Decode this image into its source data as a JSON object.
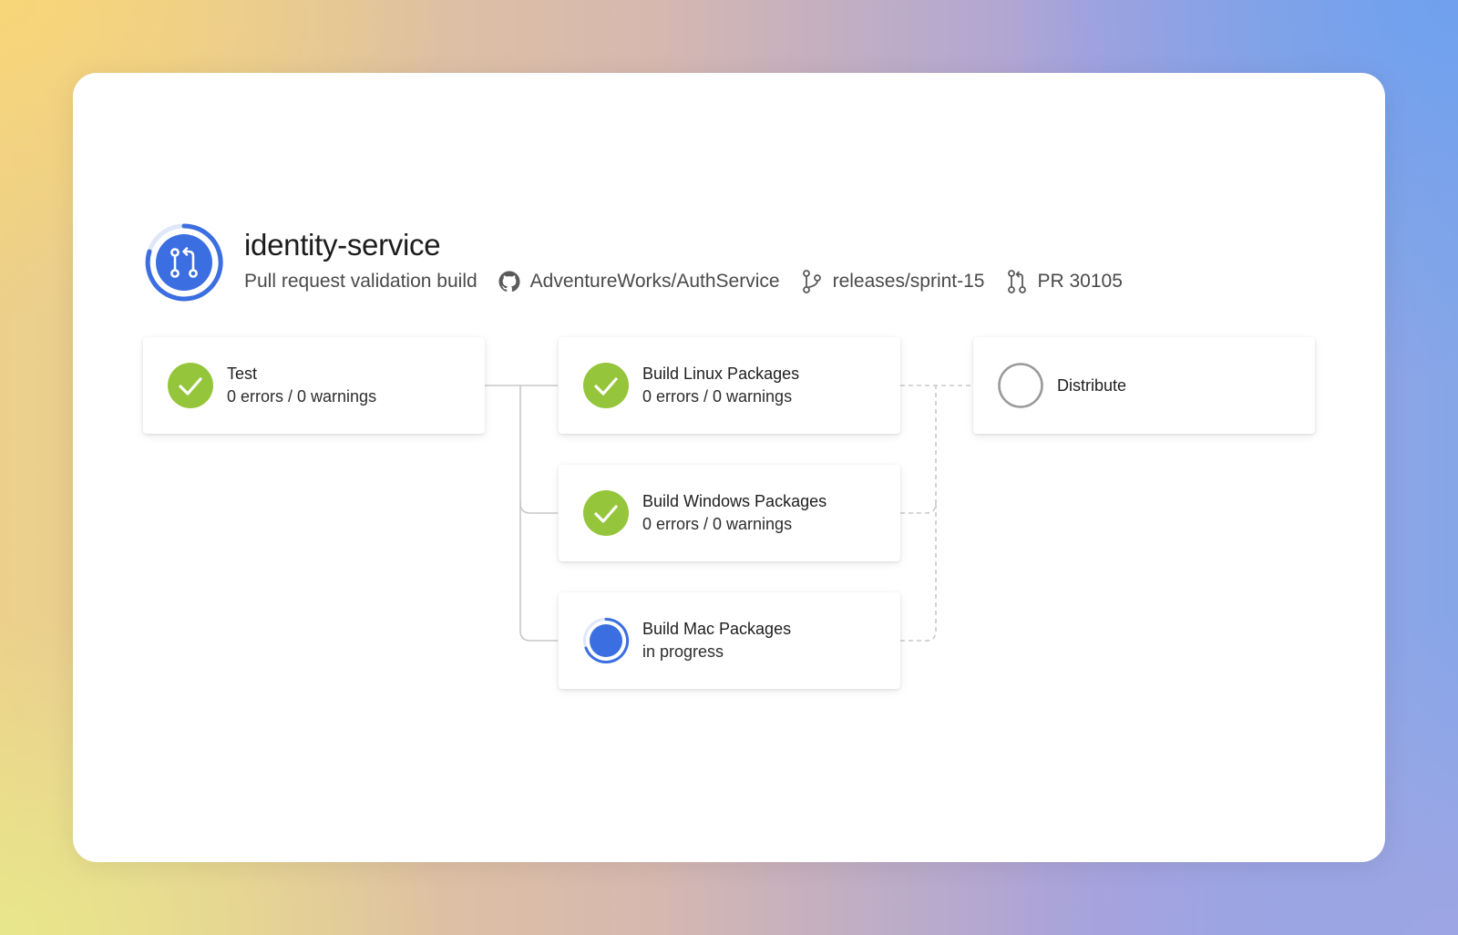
{
  "header": {
    "title": "identity-service",
    "subtitle": "Pull request validation build",
    "repo": "AdventureWorks/AuthService",
    "branch": "releases/sprint-15",
    "pull_request": "PR 30105"
  },
  "icons": {
    "pipeline": "pull-request-icon",
    "repo": "github-icon",
    "branch": "branch-icon",
    "pull_request": "pull-request-icon"
  },
  "colors": {
    "accent": "#3b6ee0",
    "success": "#95c53a",
    "pending_ring": "#9a9a9a"
  },
  "stages": {
    "test": {
      "name": "Test",
      "detail": "0 errors / 0 warnings",
      "status": "succeeded"
    },
    "linux": {
      "name": "Build Linux Packages",
      "detail": "0 errors / 0 warnings",
      "status": "succeeded"
    },
    "windows": {
      "name": "Build Windows Packages",
      "detail": "0 errors / 0 warnings",
      "status": "succeeded"
    },
    "mac": {
      "name": "Build Mac Packages",
      "detail": "in progress",
      "status": "running"
    },
    "distribute": {
      "name": "Distribute",
      "detail": "",
      "status": "not-started"
    }
  }
}
